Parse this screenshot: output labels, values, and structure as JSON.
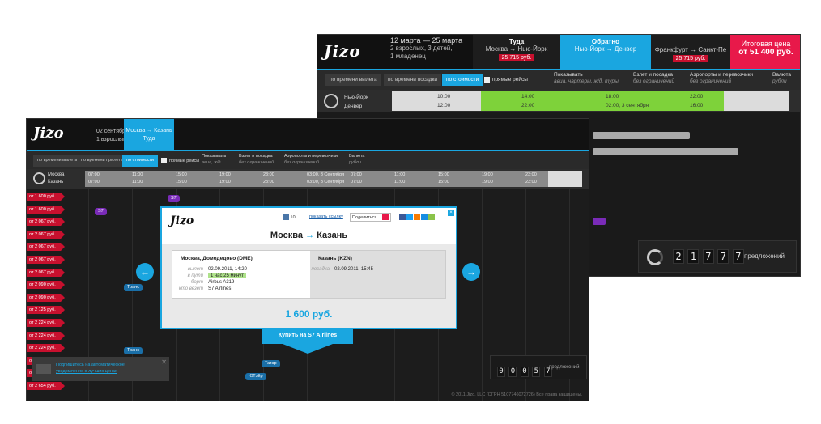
{
  "back": {
    "logo": "Jizo",
    "dates": {
      "range": "12 марта — 25 марта",
      "passengers": "2 взрослых, 3 детей,",
      "infants": "1 младенец"
    },
    "tabs": [
      {
        "title": "Туда",
        "route": "Москва → Нью-Йорк",
        "price": "25 715 руб."
      },
      {
        "title": "Обратно",
        "route": "Нью-Йорк → Денвер",
        "price": ""
      },
      {
        "title": "",
        "route": "Франкфурт → Санкт-Пе",
        "price": "25 715 руб."
      }
    ],
    "total": {
      "label": "Итоговая цена",
      "value": "от 51 400 руб."
    },
    "filters": {
      "by_departure": "по времени вылета",
      "by_arrival": "по времени посадки",
      "by_price": "по стоимости",
      "direct": "прямые рейсы",
      "show": {
        "title": "Показывать",
        "sub": "авиа, чартеры, ж/д, туры"
      },
      "takeoff": {
        "title": "Взлет и посадка",
        "sub": "без ограничений"
      },
      "airports": {
        "title": "Аэропорты и перевозчики",
        "sub": "без ограничений"
      },
      "currency": {
        "title": "Валюта",
        "sub": "рубли"
      }
    },
    "timeline": {
      "from": "Нью-Йорк",
      "to": "Денвер",
      "row1": [
        "10:00",
        "14:00",
        "18:00",
        "22:00"
      ],
      "row2": [
        "12:00",
        "22:00",
        "02:00, 3 сентября",
        "16:00"
      ]
    },
    "counter": {
      "digits": [
        "2",
        "1",
        "7",
        "7",
        "7"
      ],
      "label": "предложений"
    }
  },
  "front": {
    "logo": "Jizo",
    "dates": {
      "date": "02 сентября",
      "passengers": "1 взрослый"
    },
    "tab": {
      "route": "Москва → Казань",
      "label": "Туда"
    },
    "filters": {
      "by_departure": "по времени вылета",
      "by_arrival": "по времени прилета",
      "by_price": "по стоимости",
      "direct": "прямые рейсы",
      "show": {
        "title": "Показывать",
        "sub": "авиа, ж/д"
      },
      "takeoff": {
        "title": "Взлет и посадка",
        "sub": "без ограничений"
      },
      "airports": {
        "title": "Аэропорты и перевозчики",
        "sub": "без ограничений"
      },
      "currency": {
        "title": "Валюта",
        "sub": "рубли"
      }
    },
    "timeline": {
      "from": "Москва",
      "to": "Казань",
      "row1": [
        "07:00",
        "11:00",
        "15:00",
        "19:00",
        "23:00",
        "03:00, 3 Сентября",
        "07:00",
        "11:00",
        "15:00",
        "19:00",
        "23:00"
      ],
      "row2": [
        "07:00",
        "11:00",
        "15:00",
        "19:00",
        "23:00",
        "03:00, 3 Сентября",
        "07:00",
        "11:00",
        "15:00",
        "19:00",
        "23:00"
      ]
    },
    "prices": [
      "от 1 600 руб.",
      "от 1 600 руб.",
      "от 2 067 руб.",
      "от 2 067 руб.",
      "от 2 067 руб.",
      "от 2 067 руб.",
      "от 2 067 руб.",
      "от 2 090 руб.",
      "от 2 090 руб.",
      "от 2 125 руб.",
      "от 2 224 руб.",
      "от 2 224 руб.",
      "от 2 224 руб.",
      "от 2 654 руб.",
      "от 2 654 руб.",
      "от 2 654 руб."
    ],
    "pills": {
      "s7_top": "S7",
      "s7": "S7",
      "trans1": "Транс",
      "trans2": "Транс",
      "tatar": "Татар",
      "utair": "ЮТэйр"
    },
    "modal": {
      "logo": "Jizo",
      "share_count": "10",
      "show_link": "показать ссылку",
      "share": "Поделиться…",
      "route_from": "Москва",
      "route_to": "Казань",
      "dep_airport": "Москва, Домодедово (DME)",
      "arr_airport": "Казань (KZN)",
      "departure": {
        "key": "вылет",
        "value": "02.09.2011, 14:20"
      },
      "duration": {
        "key": "в пути",
        "value": "1 час 25 минут"
      },
      "aircraft": {
        "key": "борт",
        "value": "Airbus A319"
      },
      "carrier": {
        "key": "кто везет",
        "value": "S7 Airlines"
      },
      "landing": {
        "key": "посадка",
        "value": "02.09.2011, 15:45"
      },
      "price": "1 600 руб."
    },
    "buy": "Купить на S7 Airlines",
    "notify": {
      "line1": "Подпишитесь на автоматическое",
      "line2": "уведомление о лучших ценах"
    },
    "counter": {
      "digits": [
        "0",
        "0",
        "0",
        "5",
        "7"
      ],
      "label": "предложений"
    },
    "copyright": "© 2011 Jizo, LLC (ОГРН 5107746072726) Все права защищены."
  },
  "colors": {
    "accent": "#1aa6e0",
    "price_red": "#c8102e",
    "green": "#7ed23a",
    "total_pink": "#e8194a",
    "purple": "#7a2bb8"
  }
}
